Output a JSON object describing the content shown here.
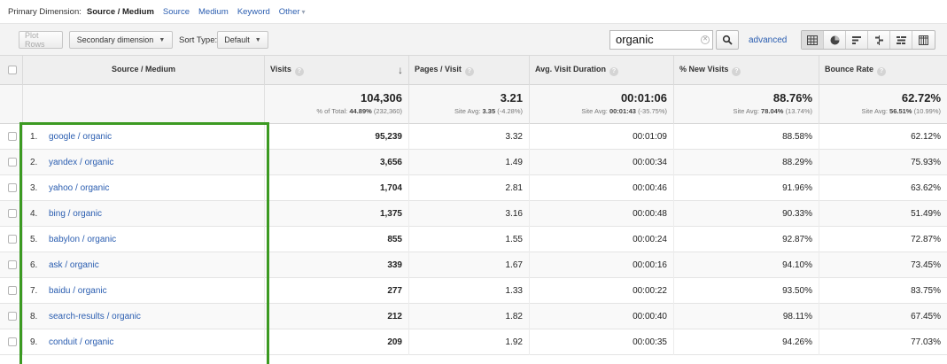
{
  "dimension_bar": {
    "label": "Primary Dimension:",
    "current": "Source / Medium",
    "links": [
      "Source",
      "Medium",
      "Keyword"
    ],
    "other": "Other"
  },
  "toolbar": {
    "plot_rows": "Plot Rows",
    "secondary_dimension": "Secondary dimension",
    "sort_type_label": "Sort Type:",
    "sort_type_value": "Default",
    "search_value": "organic",
    "advanced": "advanced"
  },
  "columns": {
    "source": "Source / Medium",
    "visits": "Visits",
    "pages": "Pages / Visit",
    "duration": "Avg. Visit Duration",
    "new_visits": "% New Visits",
    "bounce": "Bounce Rate"
  },
  "totals": {
    "visits": "104,306",
    "visits_sub_label": "% of Total:",
    "visits_sub_value": "44.89%",
    "visits_sub_detail": "(232,360)",
    "pages": "3.21",
    "pages_sub_label": "Site Avg:",
    "pages_sub_value": "3.35",
    "pages_sub_detail": "(-4.28%)",
    "duration": "00:01:06",
    "duration_sub_label": "Site Avg:",
    "duration_sub_value": "00:01:43",
    "duration_sub_detail": "(-35.75%)",
    "new_visits": "88.76%",
    "new_visits_sub_label": "Site Avg:",
    "new_visits_sub_value": "78.04%",
    "new_visits_sub_detail": "(13.74%)",
    "bounce": "62.72%",
    "bounce_sub_label": "Site Avg:",
    "bounce_sub_value": "56.51%",
    "bounce_sub_detail": "(10.99%)"
  },
  "rows": [
    {
      "num": "1.",
      "source": "google / organic",
      "visits": "95,239",
      "pages": "3.32",
      "duration": "00:01:09",
      "new_visits": "88.58%",
      "bounce": "62.12%"
    },
    {
      "num": "2.",
      "source": "yandex / organic",
      "visits": "3,656",
      "pages": "1.49",
      "duration": "00:00:34",
      "new_visits": "88.29%",
      "bounce": "75.93%"
    },
    {
      "num": "3.",
      "source": "yahoo / organic",
      "visits": "1,704",
      "pages": "2.81",
      "duration": "00:00:46",
      "new_visits": "91.96%",
      "bounce": "63.62%"
    },
    {
      "num": "4.",
      "source": "bing / organic",
      "visits": "1,375",
      "pages": "3.16",
      "duration": "00:00:48",
      "new_visits": "90.33%",
      "bounce": "51.49%"
    },
    {
      "num": "5.",
      "source": "babylon / organic",
      "visits": "855",
      "pages": "1.55",
      "duration": "00:00:24",
      "new_visits": "92.87%",
      "bounce": "72.87%"
    },
    {
      "num": "6.",
      "source": "ask / organic",
      "visits": "339",
      "pages": "1.67",
      "duration": "00:00:16",
      "new_visits": "94.10%",
      "bounce": "73.45%"
    },
    {
      "num": "7.",
      "source": "baidu / organic",
      "visits": "277",
      "pages": "1.33",
      "duration": "00:00:22",
      "new_visits": "93.50%",
      "bounce": "83.75%"
    },
    {
      "num": "8.",
      "source": "search-results / organic",
      "visits": "212",
      "pages": "1.82",
      "duration": "00:00:40",
      "new_visits": "98.11%",
      "bounce": "67.45%"
    },
    {
      "num": "9.",
      "source": "conduit / organic",
      "visits": "209",
      "pages": "1.92",
      "duration": "00:00:35",
      "new_visits": "94.26%",
      "bounce": "77.03%"
    }
  ],
  "colors": {
    "link": "#2a5db0",
    "highlight": "#3c9a22"
  },
  "icons": {
    "search": "search-icon",
    "clear": "clear-search-icon",
    "views": [
      "table-view-icon",
      "pie-view-icon",
      "performance-view-icon",
      "comparison-view-icon",
      "term-cloud-icon",
      "pivot-view-icon"
    ]
  }
}
